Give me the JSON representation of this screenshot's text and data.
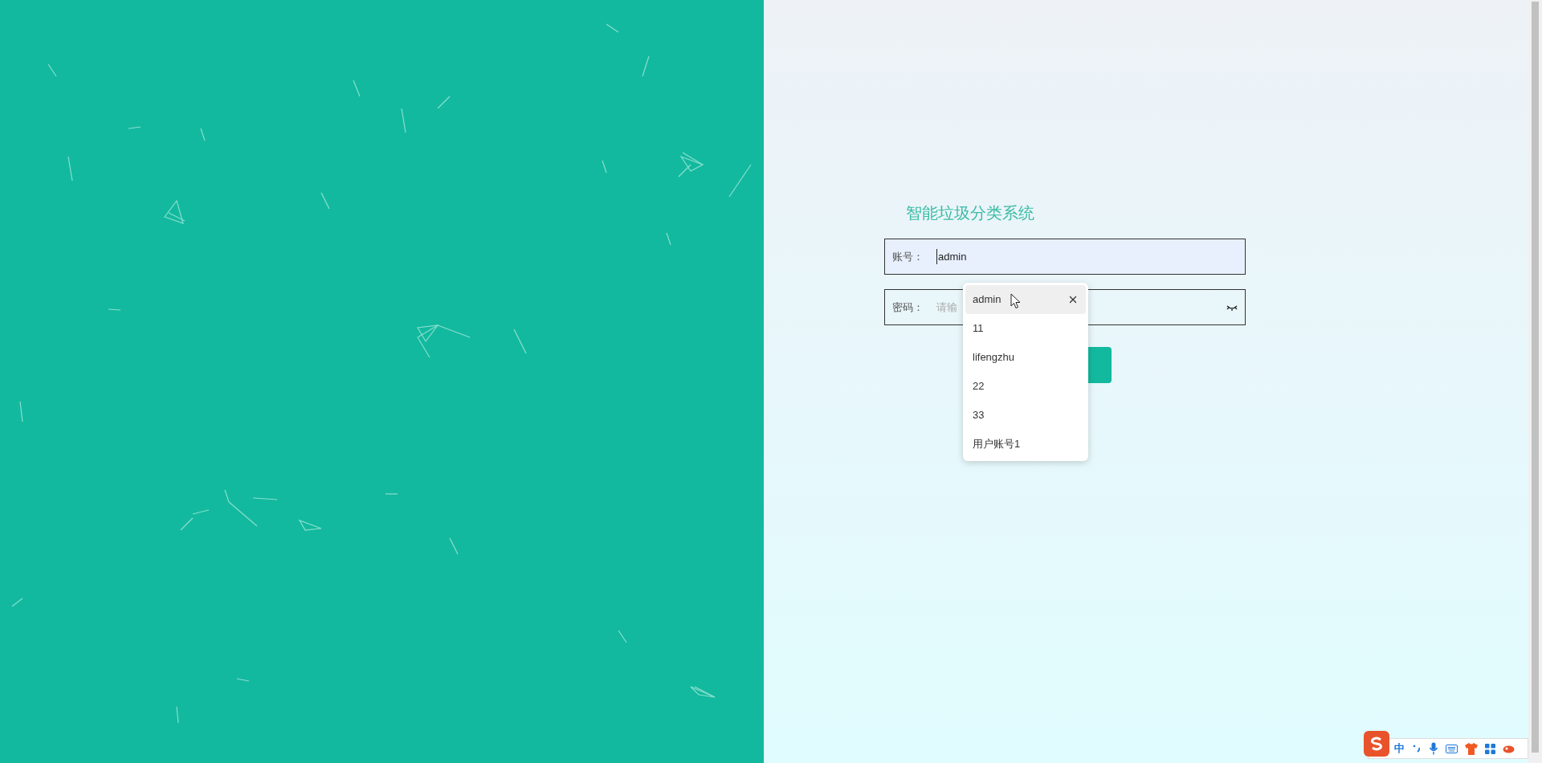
{
  "title": "智能垃圾分类系统",
  "username": {
    "label": "账号：",
    "value": "admin"
  },
  "password": {
    "label": "密码：",
    "placeholder": "请输"
  },
  "suggestions": [
    {
      "text": "admin",
      "selected": true
    },
    {
      "text": "11",
      "selected": false
    },
    {
      "text": "lifengzhu",
      "selected": false
    },
    {
      "text": "22",
      "selected": false
    },
    {
      "text": "33",
      "selected": false
    },
    {
      "text": "用户账号1",
      "selected": false
    }
  ],
  "ime": {
    "mode": "中"
  }
}
